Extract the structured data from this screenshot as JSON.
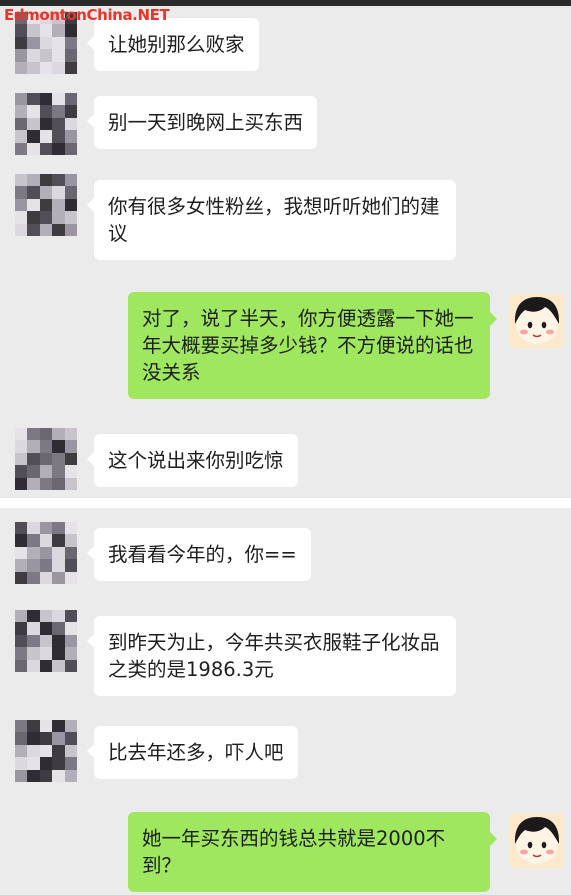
{
  "watermark": "EdmontonChina.NET",
  "messages": [
    {
      "side": "left",
      "text": "让她别那么败家"
    },
    {
      "side": "left",
      "text": "别一天到晚网上买东西"
    },
    {
      "side": "left",
      "text": "你有很多女性粉丝，我想听听她们的建议"
    },
    {
      "side": "right",
      "text": "对了，说了半天，你方便透露一下她一年大概要买掉多少钱？不方便说的话也没关系"
    },
    {
      "side": "left",
      "text": "这个说出来你别吃惊"
    },
    {
      "side": "left",
      "text": "我看看今年的，你=="
    },
    {
      "side": "left",
      "text": "到昨天为止，今年共买衣服鞋子化妆品之类的是1986.3元"
    },
    {
      "side": "left",
      "text": "比去年还多，吓人吧"
    },
    {
      "side": "right",
      "text": "她一年买东西的钱总共就是2000不到？"
    }
  ],
  "colors": {
    "chat_background": "#ebebeb",
    "incoming_bubble": "#ffffff",
    "outgoing_bubble": "#9ee75f",
    "watermark": "#e8362a"
  },
  "avatars": {
    "incoming": "pixelated-contact-avatar",
    "outgoing": "cartoon-girl-avatar"
  }
}
